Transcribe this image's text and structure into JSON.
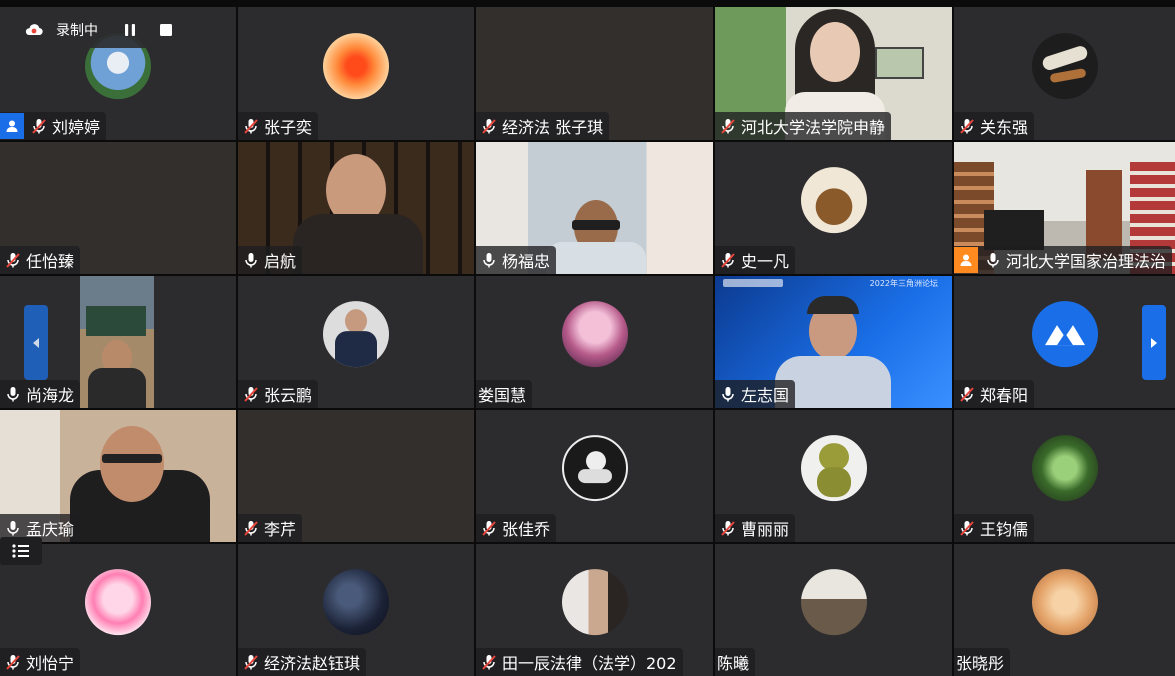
{
  "recording": {
    "label": "录制中"
  },
  "participants": [
    {
      "name": "刘婷婷",
      "mic": "muted",
      "host_badge": true
    },
    {
      "name": "张子奕",
      "mic": "muted"
    },
    {
      "name": "经济法 张子琪",
      "mic": "muted"
    },
    {
      "name": "河北大学法学院申静",
      "mic": "muted"
    },
    {
      "name": "关东强",
      "mic": "muted"
    },
    {
      "name": "任怡臻",
      "mic": "muted"
    },
    {
      "name": "启航",
      "mic": "on"
    },
    {
      "name": "杨福忠",
      "mic": "on"
    },
    {
      "name": "史一凡",
      "mic": "muted"
    },
    {
      "name": "河北大学国家治理法治",
      "mic": "on",
      "cohost_badge": true
    },
    {
      "name": "尚海龙",
      "mic": "on"
    },
    {
      "name": "张云鹏",
      "mic": "muted"
    },
    {
      "name": "娄国慧",
      "mic": "none"
    },
    {
      "name": "左志国",
      "mic": "on"
    },
    {
      "name": "郑春阳",
      "mic": "muted"
    },
    {
      "name": "孟庆瑜",
      "mic": "on"
    },
    {
      "name": "李芹",
      "mic": "muted"
    },
    {
      "name": "张佳乔",
      "mic": "muted"
    },
    {
      "name": "曹丽丽",
      "mic": "muted"
    },
    {
      "name": "王钧儒",
      "mic": "muted"
    },
    {
      "name": "刘怡宁",
      "mic": "muted"
    },
    {
      "name": "经济法赵钰琪",
      "mic": "muted"
    },
    {
      "name": "田一辰法律（法学）202",
      "mic": "muted"
    },
    {
      "name": "陈曦",
      "mic": "none"
    },
    {
      "name": "张晓彤",
      "mic": "none"
    }
  ],
  "video_overlays": {
    "banner_text": "2022年三角洲论坛"
  },
  "colors": {
    "background": "#0b0b0c",
    "tile": "#2b2b2e",
    "accent_blue": "#1a6fe8",
    "badge_orange": "#ff8a1f",
    "muted_red": "#e8453c"
  }
}
